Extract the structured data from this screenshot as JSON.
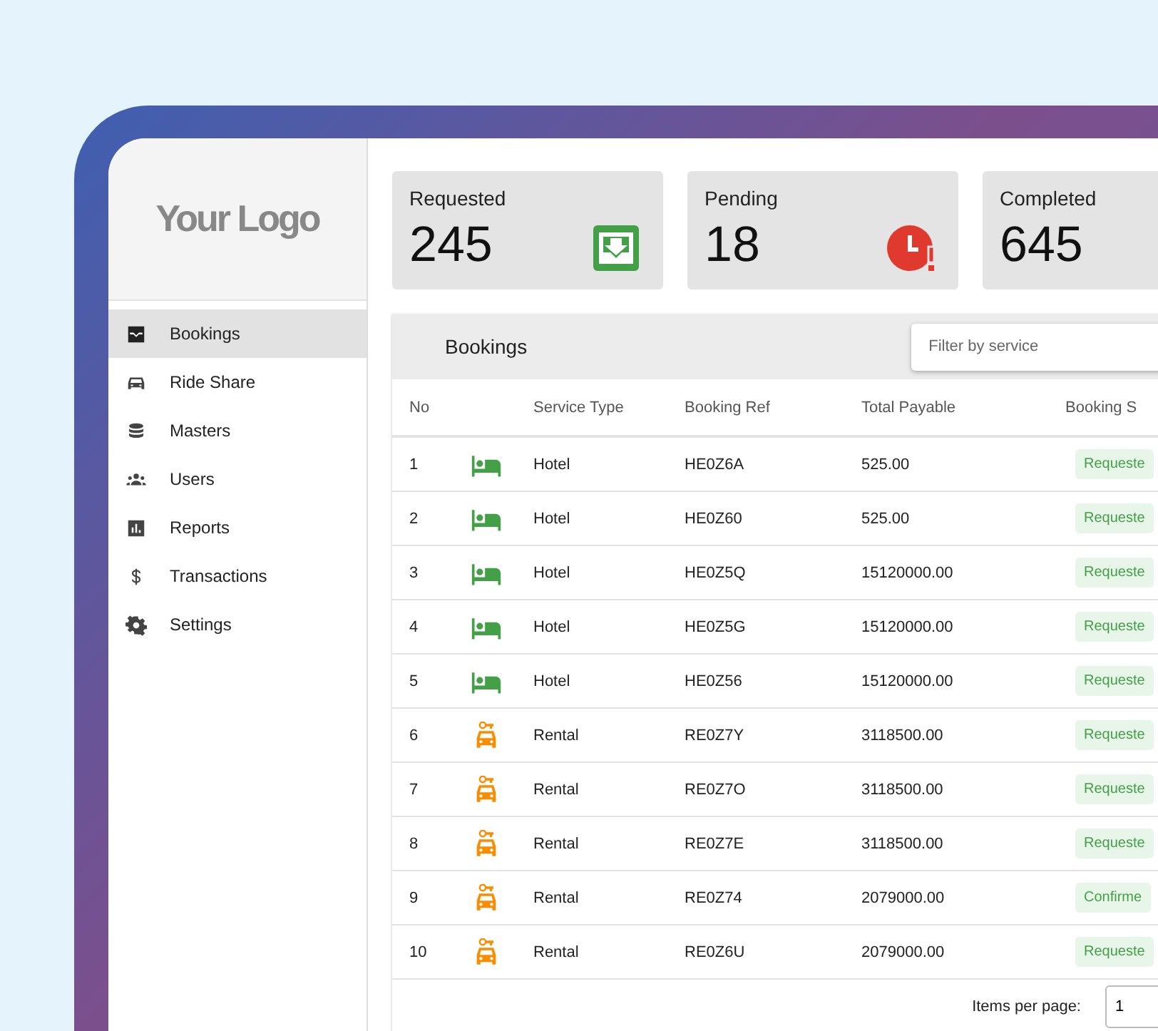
{
  "logo": "Your Logo",
  "sidebar": {
    "items": [
      {
        "label": "Bookings",
        "kind": "inbox",
        "selected": true
      },
      {
        "label": "Ride Share",
        "kind": "car",
        "selected": false
      },
      {
        "label": "Masters",
        "kind": "database",
        "selected": false
      },
      {
        "label": "Users",
        "kind": "users",
        "selected": false
      },
      {
        "label": "Reports",
        "kind": "chart",
        "selected": false
      },
      {
        "label": "Transactions",
        "kind": "dollar",
        "selected": false
      },
      {
        "label": "Settings",
        "kind": "gear",
        "selected": false
      }
    ]
  },
  "stats": [
    {
      "label": "Requested",
      "value": "245",
      "kind": "requested"
    },
    {
      "label": "Pending",
      "value": "18",
      "kind": "pending"
    },
    {
      "label": "Completed",
      "value": "645",
      "kind": "completed"
    }
  ],
  "table": {
    "title": "Bookings",
    "filter": {
      "placeholder": "Filter by service"
    },
    "columns": [
      "No",
      "Service Type",
      "Booking Ref",
      "Total Payable",
      "Booking S"
    ],
    "rows": [
      {
        "no": "1",
        "kind": "hotel",
        "service": "Hotel",
        "ref": "HE0Z6A",
        "total": "525.00",
        "status": "Requeste"
      },
      {
        "no": "2",
        "kind": "hotel",
        "service": "Hotel",
        "ref": "HE0Z60",
        "total": "525.00",
        "status": "Requeste"
      },
      {
        "no": "3",
        "kind": "hotel",
        "service": "Hotel",
        "ref": "HE0Z5Q",
        "total": "15120000.00",
        "status": "Requeste"
      },
      {
        "no": "4",
        "kind": "hotel",
        "service": "Hotel",
        "ref": "HE0Z5G",
        "total": "15120000.00",
        "status": "Requeste"
      },
      {
        "no": "5",
        "kind": "hotel",
        "service": "Hotel",
        "ref": "HE0Z56",
        "total": "15120000.00",
        "status": "Requeste"
      },
      {
        "no": "6",
        "kind": "rental",
        "service": "Rental",
        "ref": "RE0Z7Y",
        "total": "3118500.00",
        "status": "Requeste"
      },
      {
        "no": "7",
        "kind": "rental",
        "service": "Rental",
        "ref": "RE0Z7O",
        "total": "3118500.00",
        "status": "Requeste"
      },
      {
        "no": "8",
        "kind": "rental",
        "service": "Rental",
        "ref": "RE0Z7E",
        "total": "3118500.00",
        "status": "Requeste"
      },
      {
        "no": "9",
        "kind": "rental",
        "service": "Rental",
        "ref": "RE0Z74",
        "total": "2079000.00",
        "status": "Confirme"
      },
      {
        "no": "10",
        "kind": "rental",
        "service": "Rental",
        "ref": "RE0Z6U",
        "total": "2079000.00",
        "status": "Requeste"
      }
    ],
    "pagination": {
      "label": "Items per page:",
      "value": "1"
    }
  }
}
